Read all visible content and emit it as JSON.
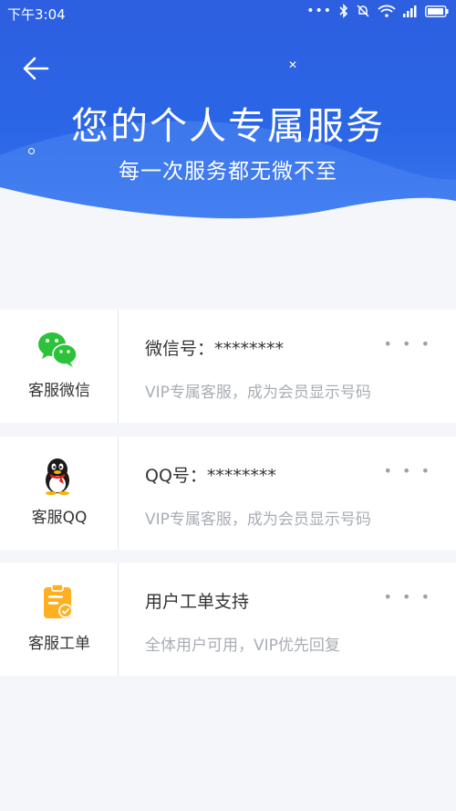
{
  "status_bar": {
    "time": "下午3:04"
  },
  "header": {
    "title": "您的个人专属服务",
    "subtitle": "每一次服务都无微不至"
  },
  "services": [
    {
      "icon_label": "客服微信",
      "title": "微信号：********",
      "desc": "VIP专属客服，成为会员显示号码",
      "icon": "wechat-icon"
    },
    {
      "icon_label": "客服QQ",
      "title": "QQ号：********",
      "desc": "VIP专属客服，成为会员显示号码",
      "icon": "qq-icon"
    },
    {
      "icon_label": "客服工单",
      "title": "用户工单支持",
      "desc": "全体用户可用，VIP优先回复",
      "icon": "ticket-icon"
    }
  ],
  "colors": {
    "hero_blue": "#2d5fe0",
    "wechat_green": "#2cc23a",
    "ticket_orange": "#ffb020"
  }
}
